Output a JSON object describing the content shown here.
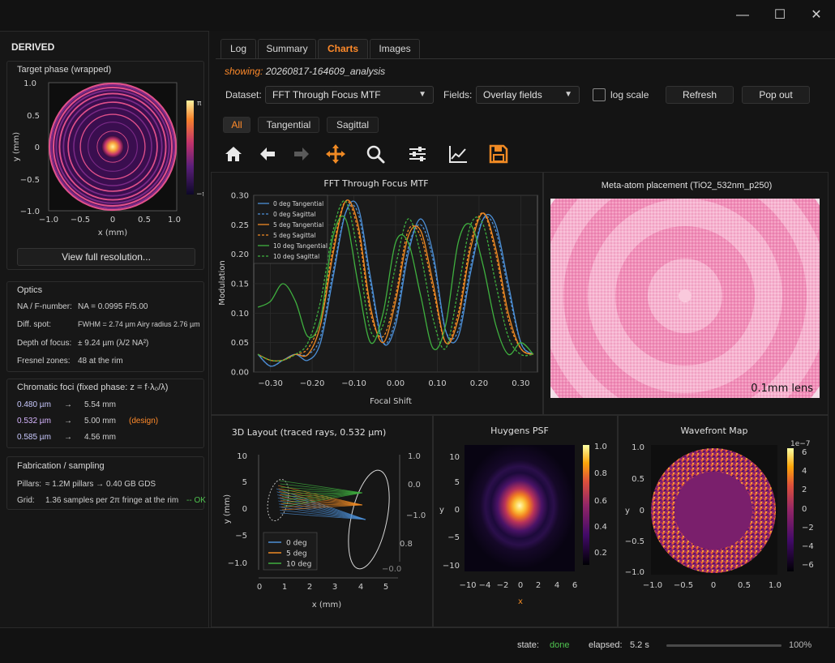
{
  "window": {
    "minimize": "—",
    "maximize": "☐",
    "close": "✕"
  },
  "sidebar": {
    "heading": "DERIVED",
    "target_phase": {
      "title": "Target phase (wrapped)",
      "y_label": "y (mm)",
      "x_label": "x (mm)",
      "x_ticks": [
        "−1.0",
        "−0.5",
        "0",
        "0.5",
        "1.0"
      ],
      "y_ticks": [
        "1.0",
        "0.5",
        "0",
        "−0.5",
        "−1.0"
      ],
      "colorbar_max": "π",
      "colorbar_min": "−π",
      "button": "View full resolution..."
    },
    "optics": {
      "title": "Optics",
      "rows": [
        {
          "label": "NA / F-number:",
          "value": "NA  =  0.0995     F/5.00"
        },
        {
          "label": "Diff. spot:",
          "value": "FWHM = 2.74 µm   Airy radius 2.76 µm"
        },
        {
          "label": "Depth of focus:",
          "value": "± 9.24 µm    (λ/2 NA²)"
        },
        {
          "label": "Fresnel zones:",
          "value": "48 at the rim"
        }
      ]
    },
    "chromatic": {
      "title": "Chromatic foci (fixed phase: z = f·λ₀/λ)",
      "rows": [
        {
          "wl": "0.480 µm",
          "arrow": "→",
          "f": "5.54 mm",
          "note": "",
          "color": "#c9c9ff"
        },
        {
          "wl": "0.532 µm",
          "arrow": "→",
          "f": "5.00 mm",
          "note": "(design)",
          "color": "#d7b6ff"
        },
        {
          "wl": "0.585 µm",
          "arrow": "→",
          "f": "4.56 mm",
          "note": "",
          "color": "#c9c9ff"
        }
      ],
      "design_color": "#ff8a2a"
    },
    "fabrication": {
      "title": "Fabrication / sampling",
      "pillars_label": "Pillars:",
      "pillars_value": "≈ 1.2M pillars   →   0.40 GB GDS",
      "grid_label": "Grid:",
      "grid_value": "1.36 samples per 2π fringe at the rim",
      "grid_ok": "-- OK",
      "ok_color": "#4fc24f"
    }
  },
  "tabs": [
    {
      "label": "Log",
      "active": false
    },
    {
      "label": "Summary",
      "active": false
    },
    {
      "label": "Charts",
      "active": true
    },
    {
      "label": "Images",
      "active": false
    }
  ],
  "showing": {
    "label": "showing:",
    "value": "20260817-164609_analysis"
  },
  "controls": {
    "dataset_label": "Dataset:",
    "dataset_value": "FFT Through Focus MTF",
    "fields_label": "Fields:",
    "fields_value": "Overlay fields",
    "log_scale_label": "log scale",
    "log_scale_checked": false,
    "refresh": "Refresh",
    "pop_out": "Pop out"
  },
  "filters": [
    {
      "label": "All",
      "active": true
    },
    {
      "label": "Tangential",
      "active": false
    },
    {
      "label": "Sagittal",
      "active": false
    }
  ],
  "toolbar": [
    "home-icon",
    "back-arrow-icon",
    "forward-arrow-icon",
    "pan-icon",
    "zoom-icon",
    "configure-icon",
    "line-chart-icon",
    "save-icon"
  ],
  "accent": "#ff8a2a",
  "meta_atom": {
    "title": "Meta-atom placement (TiO2_532nm_p250)",
    "scale_label": "0.1mm lens"
  },
  "status": {
    "state_label": "state:",
    "state_value": "done",
    "state_color": "#4fc24f",
    "elapsed_label": "elapsed:",
    "elapsed_value": "5.2 s",
    "progress": 1.0,
    "progress_label": "100%"
  },
  "chart_data": [
    {
      "type": "line",
      "title": "FFT Through Focus MTF",
      "xlabel": "Focal Shift",
      "ylabel": "Modulation",
      "xlim": [
        -0.34,
        0.34
      ],
      "ylim": [
        0.0,
        0.3
      ],
      "xticks": [
        "−0.30",
        "−0.20",
        "−0.10",
        "0.00",
        "0.10",
        "0.20",
        "0.30"
      ],
      "yticks": [
        "0.00",
        "0.05",
        "0.10",
        "0.15",
        "0.20",
        "0.25",
        "0.30"
      ],
      "legend_position": "top-left",
      "grid": true,
      "series": [
        {
          "name": "0 deg  Tangential",
          "color": "#4c8fd6",
          "dash": false,
          "x": [
            -0.33,
            -0.3,
            -0.27,
            -0.24,
            -0.21,
            -0.18,
            -0.15,
            -0.12,
            -0.09,
            -0.06,
            -0.03,
            0.0,
            0.03,
            0.06,
            0.09,
            0.12,
            0.15,
            0.18,
            0.21,
            0.24,
            0.27,
            0.3,
            0.33
          ],
          "y": [
            0.03,
            0.01,
            0.02,
            0.03,
            0.02,
            0.05,
            0.16,
            0.27,
            0.28,
            0.16,
            0.05,
            0.08,
            0.2,
            0.26,
            0.2,
            0.07,
            0.06,
            0.17,
            0.26,
            0.25,
            0.15,
            0.05,
            0.03
          ]
        },
        {
          "name": "0 deg  Sagittal",
          "color": "#4c8fd6",
          "dash": true,
          "x": [
            -0.33,
            -0.3,
            -0.27,
            -0.24,
            -0.21,
            -0.18,
            -0.15,
            -0.12,
            -0.09,
            -0.06,
            -0.03,
            0.0,
            0.03,
            0.06,
            0.09,
            0.12,
            0.15,
            0.18,
            0.21,
            0.24,
            0.27,
            0.3,
            0.33
          ],
          "y": [
            0.03,
            0.01,
            0.02,
            0.03,
            0.03,
            0.06,
            0.17,
            0.27,
            0.27,
            0.15,
            0.05,
            0.09,
            0.21,
            0.25,
            0.19,
            0.07,
            0.07,
            0.18,
            0.26,
            0.24,
            0.14,
            0.05,
            0.03
          ]
        },
        {
          "name": "5 deg  Tangential",
          "color": "#f08a24",
          "dash": false,
          "x": [
            -0.33,
            -0.3,
            -0.27,
            -0.24,
            -0.21,
            -0.18,
            -0.15,
            -0.12,
            -0.09,
            -0.06,
            -0.03,
            0.0,
            0.03,
            0.06,
            0.09,
            0.12,
            0.15,
            0.18,
            0.21,
            0.24,
            0.27,
            0.3,
            0.33
          ],
          "y": [
            0.03,
            0.02,
            0.02,
            0.03,
            0.03,
            0.08,
            0.2,
            0.29,
            0.25,
            0.11,
            0.05,
            0.12,
            0.23,
            0.24,
            0.15,
            0.05,
            0.09,
            0.21,
            0.27,
            0.21,
            0.1,
            0.04,
            0.03
          ]
        },
        {
          "name": "5 deg  Sagittal",
          "color": "#f08a24",
          "dash": true,
          "x": [
            -0.33,
            -0.3,
            -0.27,
            -0.24,
            -0.21,
            -0.18,
            -0.15,
            -0.12,
            -0.09,
            -0.06,
            -0.03,
            0.0,
            0.03,
            0.06,
            0.09,
            0.12,
            0.15,
            0.18,
            0.21,
            0.24,
            0.27,
            0.3,
            0.33
          ],
          "y": [
            0.03,
            0.02,
            0.02,
            0.03,
            0.04,
            0.09,
            0.21,
            0.29,
            0.24,
            0.1,
            0.06,
            0.13,
            0.24,
            0.23,
            0.14,
            0.05,
            0.1,
            0.22,
            0.27,
            0.2,
            0.09,
            0.04,
            0.03
          ]
        },
        {
          "name": "10 deg Tangential",
          "color": "#3fb03f",
          "dash": false,
          "x": [
            -0.33,
            -0.3,
            -0.27,
            -0.24,
            -0.21,
            -0.18,
            -0.15,
            -0.12,
            -0.09,
            -0.06,
            -0.03,
            0.0,
            0.03,
            0.06,
            0.09,
            0.12,
            0.15,
            0.18,
            0.21,
            0.24,
            0.27,
            0.3,
            0.33
          ],
          "y": [
            0.11,
            0.12,
            0.15,
            0.12,
            0.06,
            0.09,
            0.23,
            0.26,
            0.15,
            0.05,
            0.1,
            0.22,
            0.22,
            0.13,
            0.04,
            0.08,
            0.22,
            0.25,
            0.18,
            0.08,
            0.03,
            0.05,
            0.03
          ]
        },
        {
          "name": "10 deg Sagittal",
          "color": "#3fb03f",
          "dash": true,
          "x": [
            -0.33,
            -0.3,
            -0.27,
            -0.24,
            -0.21,
            -0.18,
            -0.15,
            -0.12,
            -0.09,
            -0.06,
            -0.03,
            0.0,
            0.03,
            0.06,
            0.09,
            0.12,
            0.15,
            0.18,
            0.21,
            0.24,
            0.27,
            0.3,
            0.33
          ],
          "y": [
            0.03,
            0.02,
            0.02,
            0.03,
            0.05,
            0.12,
            0.24,
            0.29,
            0.2,
            0.07,
            0.08,
            0.18,
            0.26,
            0.2,
            0.09,
            0.04,
            0.14,
            0.25,
            0.25,
            0.15,
            0.06,
            0.03,
            0.03
          ]
        }
      ]
    },
    {
      "type": "line",
      "title": "3D Layout (traced rays, 0.532 µm)",
      "xlabel": "x (mm)",
      "ylabel": "y (mm)",
      "xticks": [
        "0",
        "1",
        "2",
        "3",
        "4",
        "5"
      ],
      "yticks": [
        "10",
        "5",
        "0",
        "−5",
        "−1.0"
      ],
      "zticks": [
        "1.0",
        "0.0",
        "−1.0",
        "0.8",
        "−0.0"
      ],
      "legend_position": "bottom-left",
      "series": [
        {
          "name": "0 deg",
          "color": "#4c8fd6"
        },
        {
          "name": "5 deg",
          "color": "#f08a24"
        },
        {
          "name": "10 deg",
          "color": "#3fb03f"
        }
      ]
    },
    {
      "type": "heatmap",
      "title": "Huygens PSF",
      "xlabel": "x",
      "ylabel": "y",
      "xticks": [
        "−10",
        "−4",
        "−2",
        "0",
        "2",
        "4",
        "6"
      ],
      "yticks": [
        "10",
        "5",
        "0",
        "−5",
        "−10"
      ],
      "colorbar_ticks": [
        "1.0",
        "0.8",
        "0.6",
        "0.4",
        "0.2"
      ],
      "colormap": "inferno"
    },
    {
      "type": "heatmap",
      "title": "Wavefront Map",
      "ylabel": "y",
      "xticks": [
        "−1.0",
        "−0.5",
        "0",
        "0.5",
        "1.0"
      ],
      "yticks": [
        "1.0",
        "0.5",
        "0",
        "−0.5",
        "−1.0"
      ],
      "colorbar_ticks": [
        "6",
        "4",
        "2",
        "0",
        "−2",
        "−4",
        "−6"
      ],
      "colorbar_exponent": "1e−7",
      "colormap": "inferno"
    }
  ]
}
